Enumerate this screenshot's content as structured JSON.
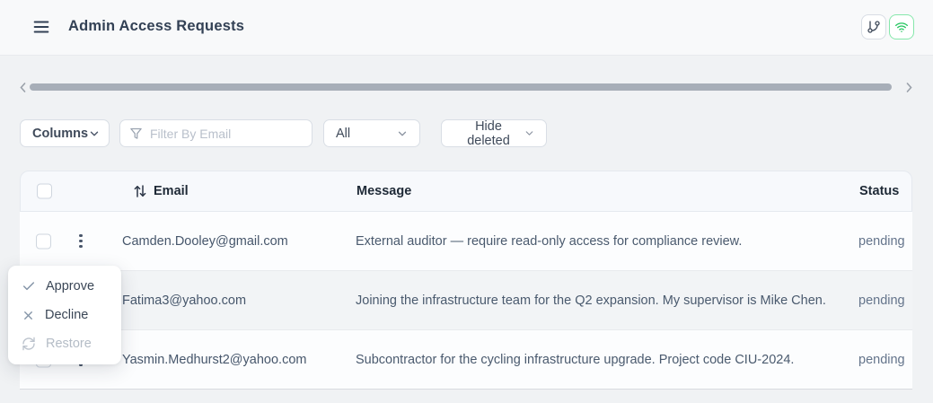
{
  "header": {
    "title": "Admin Access Requests"
  },
  "toolbar": {
    "columns_label": "Columns",
    "email_filter_placeholder": "Filter By Email",
    "status_filter_value": "All",
    "deleted_filter_value": "Hide deleted"
  },
  "table": {
    "columns": [
      "Email",
      "Message",
      "Status"
    ],
    "rows": [
      {
        "email": "Camden.Dooley@gmail.com",
        "message": "External auditor — require read-only access for compliance review.",
        "status": "pending"
      },
      {
        "email": "Fatima3@yahoo.com",
        "message": "Joining the infrastructure team for the Q2 expansion. My supervisor is Mike Chen.",
        "status": "pending"
      },
      {
        "email": "Yasmin.Medhurst2@yahoo.com",
        "message": "Subcontractor for the cycling infrastructure upgrade. Project code CIU-2024.",
        "status": "pending"
      }
    ]
  },
  "context_menu": {
    "items": [
      {
        "label": "Approve",
        "icon": "check-icon",
        "enabled": true
      },
      {
        "label": "Decline",
        "icon": "x-icon",
        "enabled": true
      },
      {
        "label": "Restore",
        "icon": "restore-icon",
        "enabled": false
      }
    ]
  },
  "icons": {
    "menu": "hamburger-icon",
    "branch": "git-branch-icon",
    "wifi": "wifi-icon",
    "filter": "funnel-icon",
    "sort": "sort-arrows-icon",
    "row_actions": "kebab-icon"
  },
  "colors": {
    "accent_green": "#22c55e",
    "title_text": "#334155",
    "pending_status": "#64748b",
    "scrollbar_thumb": "#a7aeb8"
  }
}
